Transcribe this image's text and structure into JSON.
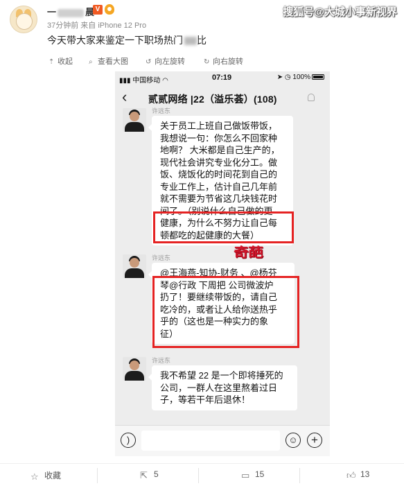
{
  "post": {
    "username_prefix": "一",
    "username_suffix": "晨",
    "vip_badge": "V",
    "meta": "37分钟前 来自 iPhone 12 Pro",
    "watermark": "搜狐号@大城小事新视界",
    "text": "今天带大家来鉴定一下职场热门",
    "text_tail": "比"
  },
  "image_toolbar": {
    "collapse": "收起",
    "view_large": "查看大图",
    "rotate_left": "向左旋转",
    "rotate_right": "向右旋转"
  },
  "phone": {
    "carrier": "中国移动",
    "time": "07:19",
    "battery": "100%",
    "chat_title": "贰贰网络 |22（溢乐荟）(108)",
    "messages": [
      {
        "sender": "许远东",
        "lines": [
          "关于员工上班自己做饭带饭，",
          "我想说一句：你怎么不回家种",
          "地啊？ 大米都是自己生产的，",
          "现代社会讲究专业化分工。做",
          "饭、烧饭化的时间花到自己的",
          "专业工作上，估计自己几年前",
          "就不需要为节省这几块钱花时",
          "间了。（别说什么自己做的更",
          "健康，为什么不努力让自己每",
          "顿都吃的起健康的大餐）"
        ]
      },
      {
        "sender": "许远东",
        "lines": [
          "@王海燕-知协-财务 、@杨芬",
          "琴@行政  下周把 公司微波炉",
          "扔了！要继续带饭的，请自己",
          "吃冷的，或者让人给你送热乎",
          "乎的（这也是一种实力的象",
          "征）"
        ]
      },
      {
        "sender": "许远东",
        "lines": [
          "我不希望 22 是一个即将捶死的",
          "公司，一群人在这里熬着过日",
          "子，等若干年后退休！"
        ]
      }
    ],
    "stamp_text": "奇葩"
  },
  "actions": {
    "favorite": "收藏",
    "repost_count": "5",
    "comment_count": "15",
    "like_count": "13"
  },
  "colors": {
    "highlight": "#e52222",
    "chat_bg": "#ededed",
    "vip": "#f05a23"
  }
}
